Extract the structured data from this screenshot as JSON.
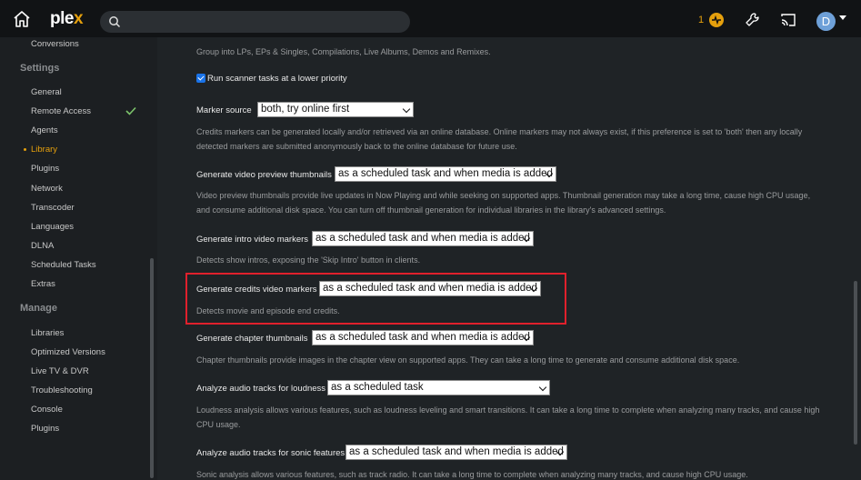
{
  "topbar": {
    "logo_main": "ple",
    "logo_x": "x",
    "search_placeholder": "",
    "activity_count": "1",
    "avatar_initial": "D"
  },
  "sidebar": {
    "top_item": "Conversions",
    "settings_header": "Settings",
    "settings_items": [
      "General",
      "Remote Access",
      "Agents",
      "Library",
      "Plugins",
      "Network",
      "Transcoder",
      "Languages",
      "DLNA",
      "Scheduled Tasks",
      "Extras"
    ],
    "active_item": "Library",
    "manage_header": "Manage",
    "manage_items": [
      "Libraries",
      "Optimized Versions",
      "Live TV & DVR",
      "Troubleshooting",
      "Console",
      "Plugins"
    ]
  },
  "main": {
    "group_desc": "Group into LPs, EPs & Singles, Compilations, Live Albums, Demos and Remixes.",
    "scanner_label": "Run scanner tasks at a lower priority",
    "marker_source": {
      "label": "Marker source",
      "value": "both, try online first",
      "desc1": "Credits markers can be generated locally and/or retrieved via an online database. Online markers may not always exist, if this preference is set to 'both' then any locally",
      "desc2": "detected markers are submitted anonymously back to the online database for future use."
    },
    "video_preview": {
      "label": "Generate video preview thumbnails",
      "value": "as a scheduled task and when media is added",
      "desc1": "Video preview thumbnails provide live updates in Now Playing and while seeking on supported apps. Thumbnail generation may take a long time, cause high CPU usage,",
      "desc2": "and consume additional disk space. You can turn off thumbnail generation for individual libraries in the library's advanced settings."
    },
    "intro_markers": {
      "label": "Generate intro video markers",
      "value": "as a scheduled task and when media is added",
      "desc1": "Detects show intros, exposing the 'Skip Intro' button in clients."
    },
    "credits_markers": {
      "label": "Generate credits video markers",
      "value": "as a scheduled task and when media is added",
      "desc1": "Detects movie and episode end credits."
    },
    "chapter_thumbs": {
      "label": "Generate chapter thumbnails",
      "value": "as a scheduled task and when media is added",
      "desc1": "Chapter thumbnails provide images in the chapter view on supported apps. They can take a long time to generate and consume additional disk space."
    },
    "loudness": {
      "label": "Analyze audio tracks for loudness",
      "value": "as a scheduled task",
      "desc1": "Loudness analysis allows various features, such as loudness leveling and smart transitions. It can take a long time to complete when analyzing many tracks, and cause high",
      "desc2": "CPU usage."
    },
    "sonic": {
      "label": "Analyze audio tracks for sonic features",
      "value": "as a scheduled task and when media is added",
      "desc1": "Sonic analysis allows various features, such as track radio. It can take a long time to complete when analyzing many tracks, and cause high CPU usage."
    }
  },
  "colors": {
    "accent": "#e5a00d",
    "highlight": "#e0202c",
    "checkbox": "#1a73e8",
    "check_green": "#7cc36b"
  }
}
